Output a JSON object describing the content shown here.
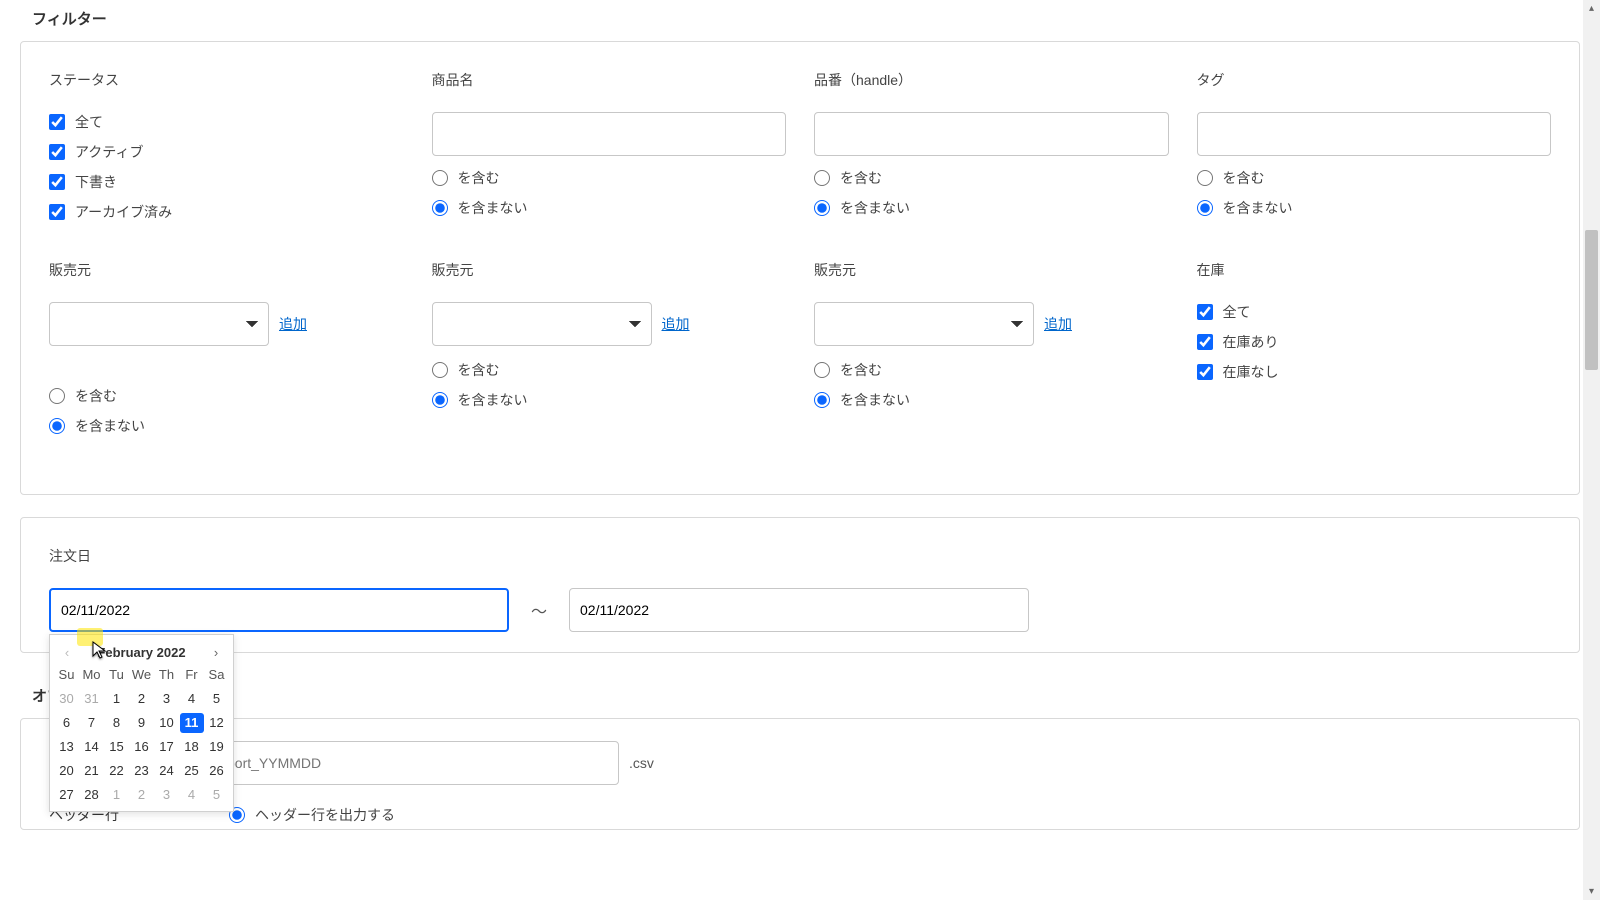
{
  "title": "フィルター",
  "filters": {
    "status": {
      "label": "ステータス",
      "all": "全て",
      "active": "アクティブ",
      "draft": "下書き",
      "archived": "アーカイブ済み"
    },
    "product_name": {
      "label": "商品名",
      "include": "を含む",
      "exclude": "を含まない"
    },
    "handle": {
      "label": "品番（handle）",
      "include": "を含む",
      "exclude": "を含まない"
    },
    "tag": {
      "label": "タグ",
      "include": "を含む",
      "exclude": "を含まない"
    },
    "vendor1": {
      "label": "販売元",
      "add": "追加",
      "include": "を含む",
      "exclude": "を含まない"
    },
    "vendor2": {
      "label": "販売元",
      "add": "追加",
      "include": "を含む",
      "exclude": "を含まない"
    },
    "vendor3": {
      "label": "販売元",
      "add": "追加",
      "include": "を含む",
      "exclude": "を含まない"
    },
    "stock": {
      "label": "在庫",
      "all": "全て",
      "instock": "在庫あり",
      "nostock": "在庫なし"
    }
  },
  "order_date": {
    "label": "注文日",
    "from": "02/11/2022",
    "tilde": "～",
    "to": "02/11/2022"
  },
  "datepicker": {
    "title": "February 2022",
    "dows": [
      "Su",
      "Mo",
      "Tu",
      "We",
      "Th",
      "Fr",
      "Sa"
    ],
    "rows": [
      [
        {
          "n": "30",
          "m": true
        },
        {
          "n": "31",
          "m": true
        },
        {
          "n": "1"
        },
        {
          "n": "2"
        },
        {
          "n": "3"
        },
        {
          "n": "4"
        },
        {
          "n": "5"
        }
      ],
      [
        {
          "n": "6"
        },
        {
          "n": "7"
        },
        {
          "n": "8"
        },
        {
          "n": "9"
        },
        {
          "n": "10"
        },
        {
          "n": "11",
          "sel": true
        },
        {
          "n": "12"
        }
      ],
      [
        {
          "n": "13"
        },
        {
          "n": "14"
        },
        {
          "n": "15"
        },
        {
          "n": "16"
        },
        {
          "n": "17"
        },
        {
          "n": "18"
        },
        {
          "n": "19"
        }
      ],
      [
        {
          "n": "20"
        },
        {
          "n": "21"
        },
        {
          "n": "22"
        },
        {
          "n": "23"
        },
        {
          "n": "24"
        },
        {
          "n": "25"
        },
        {
          "n": "26"
        }
      ],
      [
        {
          "n": "27"
        },
        {
          "n": "28"
        },
        {
          "n": "1",
          "m": true
        },
        {
          "n": "2",
          "m": true
        },
        {
          "n": "3",
          "m": true
        },
        {
          "n": "4",
          "m": true
        },
        {
          "n": "5",
          "m": true
        }
      ]
    ]
  },
  "options_title": "オプ",
  "file": {
    "placeholder": "xport_YYMMDD",
    "ext": ".csv"
  },
  "header_row": {
    "label": "ヘッダー行",
    "option": "ヘッダー行を出力する"
  }
}
